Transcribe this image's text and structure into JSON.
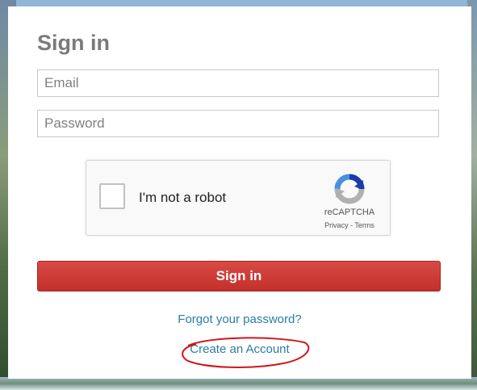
{
  "signin": {
    "title": "Sign in",
    "email_placeholder": "Email",
    "password_placeholder": "Password",
    "button_label": "Sign in",
    "forgot_link": "Forgot your password?",
    "create_link": "Create an Account"
  },
  "captcha": {
    "label": "I'm not a robot",
    "brand": "reCAPTCHA",
    "privacy": "Privacy",
    "separator": " - ",
    "terms": "Terms"
  },
  "colors": {
    "button": "#c8342e",
    "link": "#2b7ea1",
    "annotation": "#d0161b"
  },
  "icons": {
    "captcha_logo": "recaptcha-logo-icon"
  }
}
